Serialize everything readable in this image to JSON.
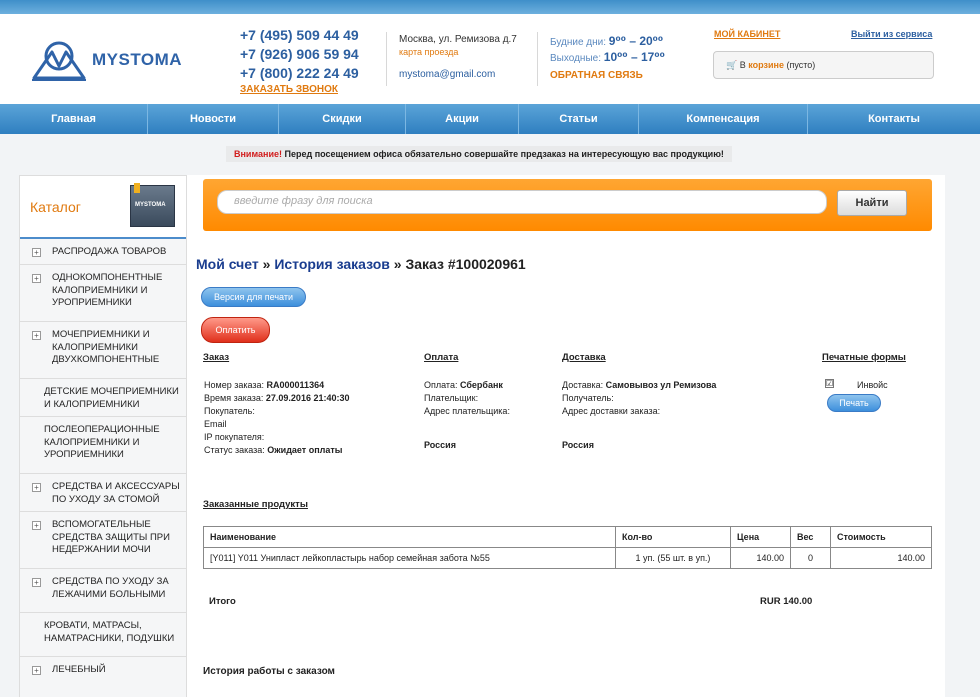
{
  "header": {
    "logo_text": "MYSTOMA",
    "phones": [
      "+7 (495) 509 44 49",
      "+7 (926) 906 59 94",
      "+7 (800) 222 24 49"
    ],
    "callback": "ЗАКАЗАТЬ ЗВОНОК",
    "address": "Москва, ул. Ремизова д.7",
    "map_link": "карта проезда",
    "email": "mystoma@gmail.com",
    "weekdays_label": "Будние дни:",
    "weekdays_hours": "9⁰⁰ – 20⁰⁰",
    "weekend_label": "Выходные:",
    "weekend_hours": "10⁰⁰ – 17⁰⁰",
    "feedback": "ОБРАТНАЯ СВЯЗЬ",
    "cabinet": "МОЙ КАБИНЕТ",
    "logout": "Выйти из сервиса",
    "cart_prefix": "В",
    "cart_link": "корзине",
    "cart_status": "(пусто)"
  },
  "nav": [
    "Главная",
    "Новости",
    "Скидки",
    "Акции",
    "Статьи",
    "Компенсация",
    "Контакты"
  ],
  "notice": {
    "warn": "Внимание!",
    "text": "Перед посещением офиса обязательно совершайте предзаказ на интересующую вас продукцию!"
  },
  "sidebar": {
    "title": "Каталог",
    "image_text": "MYSTOMA",
    "items": [
      {
        "label": "РАСПРОДАЖА ТОВАРОВ",
        "plus": true
      },
      {
        "label": "ОДНОКОМПОНЕНТНЫЕ КАЛОПРИЕМНИКИ И УРОПРИЕМНИКИ",
        "plus": true
      },
      {
        "label": "МОЧЕПРИЕМНИКИ И КАЛОПРИЕМНИКИ ДВУХКОМПОНЕНТНЫЕ",
        "plus": true
      },
      {
        "label": "ДЕТСКИЕ МОЧЕПРИЕМНИКИ И КАЛОПРИЕМНИКИ",
        "plus": false
      },
      {
        "label": "ПОСЛЕОПЕРАЦИОННЫЕ КАЛОПРИЕМНИКИ И УРОПРИЕМНИКИ",
        "plus": false
      },
      {
        "label": "СРЕДСТВА И АКСЕССУАРЫ ПО УХОДУ ЗА СТОМОЙ",
        "plus": true
      },
      {
        "label": "ВСПОМОГАТЕЛЬНЫЕ СРЕДСТВА ЗАЩИТЫ ПРИ НЕДЕРЖАНИИ МОЧИ",
        "plus": true
      },
      {
        "label": "СРЕДСТВА ПО УХОДУ ЗА ЛЕЖАЧИМИ БОЛЬНЫМИ",
        "plus": true
      },
      {
        "label": "КРОВАТИ, МАТРАСЫ, НАМАТРАСНИКИ, ПОДУШКИ",
        "plus": false
      },
      {
        "label": "ЛЕЧЕБНЫЙ",
        "plus": true
      }
    ]
  },
  "search": {
    "placeholder": "введите фразу для поиска",
    "button": "Найти"
  },
  "breadcrumb": {
    "account": "Мой счет",
    "sep": "»",
    "history": "История заказов",
    "current": "» Заказ #100020961"
  },
  "buttons": {
    "print_version": "Версия для печати",
    "pay": "Оплатить",
    "print": "Печать"
  },
  "order": {
    "head": "Заказ",
    "number_label": "Номер заказа:",
    "number": "RA000011364",
    "time_label": "Время заказа:",
    "time": "27.09.2016 21:40:30",
    "buyer_label": "Покупатель:",
    "email_label": "Email",
    "ip_label": "IP покупателя:",
    "status_label": "Статус заказа:",
    "status": "Ожидает оплаты"
  },
  "payment": {
    "head": "Оплата",
    "method_label": "Оплата:",
    "method": "Сбербанк",
    "payer_label": "Плательщик:",
    "payer_address_label": "Адрес плательщика:",
    "country": "Россия"
  },
  "delivery": {
    "head": "Доставка",
    "method_label": "Доставка:",
    "method": "Самовывоз ул Ремизова",
    "receiver_label": "Получатель:",
    "address_label": "Адрес доставки заказа:",
    "country": "Россия"
  },
  "print_forms": {
    "head": "Печатные формы",
    "invoice": "Инвойс",
    "check": "☑"
  },
  "products": {
    "head": "Заказанные продукты",
    "columns": [
      "Наименование",
      "Кол-во",
      "Цена",
      "Вес",
      "Стоимость"
    ],
    "rows": [
      {
        "name": "[Y011] Y011 Унипласт лейкопластырь набор семейная забота №55",
        "qty": "1 уп. (55 шт. в уп.)",
        "price": "140.00",
        "weight": "0",
        "cost": "140.00"
      }
    ]
  },
  "total": {
    "label": "Итого",
    "value": "RUR 140.00"
  },
  "history_title": "История работы с заказом",
  "colors": {
    "accent": "#e07a10",
    "nav": "#2f7fc0",
    "link": "#1a3d8f"
  }
}
